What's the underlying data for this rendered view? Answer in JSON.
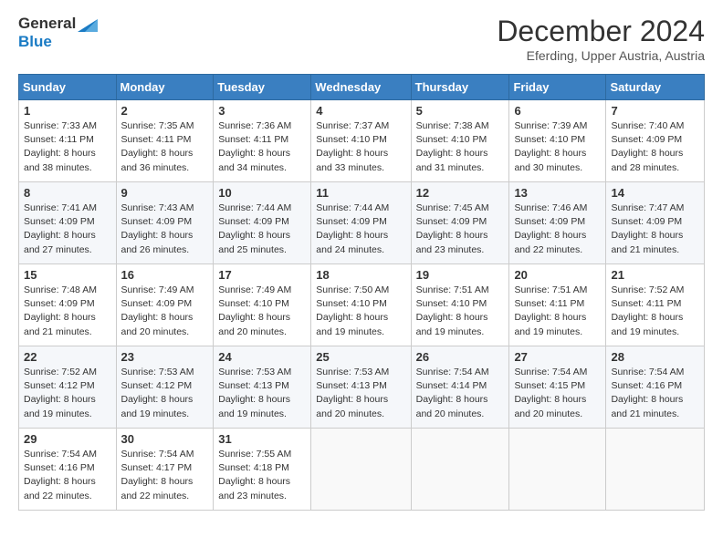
{
  "logo": {
    "line1": "General",
    "line2": "Blue"
  },
  "header": {
    "month": "December 2024",
    "location": "Eferding, Upper Austria, Austria"
  },
  "weekdays": [
    "Sunday",
    "Monday",
    "Tuesday",
    "Wednesday",
    "Thursday",
    "Friday",
    "Saturday"
  ],
  "weeks": [
    [
      {
        "day": "1",
        "sunrise": "7:33 AM",
        "sunset": "4:11 PM",
        "daylight": "8 hours and 38 minutes."
      },
      {
        "day": "2",
        "sunrise": "7:35 AM",
        "sunset": "4:11 PM",
        "daylight": "8 hours and 36 minutes."
      },
      {
        "day": "3",
        "sunrise": "7:36 AM",
        "sunset": "4:11 PM",
        "daylight": "8 hours and 34 minutes."
      },
      {
        "day": "4",
        "sunrise": "7:37 AM",
        "sunset": "4:10 PM",
        "daylight": "8 hours and 33 minutes."
      },
      {
        "day": "5",
        "sunrise": "7:38 AM",
        "sunset": "4:10 PM",
        "daylight": "8 hours and 31 minutes."
      },
      {
        "day": "6",
        "sunrise": "7:39 AM",
        "sunset": "4:10 PM",
        "daylight": "8 hours and 30 minutes."
      },
      {
        "day": "7",
        "sunrise": "7:40 AM",
        "sunset": "4:09 PM",
        "daylight": "8 hours and 28 minutes."
      }
    ],
    [
      {
        "day": "8",
        "sunrise": "7:41 AM",
        "sunset": "4:09 PM",
        "daylight": "8 hours and 27 minutes."
      },
      {
        "day": "9",
        "sunrise": "7:43 AM",
        "sunset": "4:09 PM",
        "daylight": "8 hours and 26 minutes."
      },
      {
        "day": "10",
        "sunrise": "7:44 AM",
        "sunset": "4:09 PM",
        "daylight": "8 hours and 25 minutes."
      },
      {
        "day": "11",
        "sunrise": "7:44 AM",
        "sunset": "4:09 PM",
        "daylight": "8 hours and 24 minutes."
      },
      {
        "day": "12",
        "sunrise": "7:45 AM",
        "sunset": "4:09 PM",
        "daylight": "8 hours and 23 minutes."
      },
      {
        "day": "13",
        "sunrise": "7:46 AM",
        "sunset": "4:09 PM",
        "daylight": "8 hours and 22 minutes."
      },
      {
        "day": "14",
        "sunrise": "7:47 AM",
        "sunset": "4:09 PM",
        "daylight": "8 hours and 21 minutes."
      }
    ],
    [
      {
        "day": "15",
        "sunrise": "7:48 AM",
        "sunset": "4:09 PM",
        "daylight": "8 hours and 21 minutes."
      },
      {
        "day": "16",
        "sunrise": "7:49 AM",
        "sunset": "4:09 PM",
        "daylight": "8 hours and 20 minutes."
      },
      {
        "day": "17",
        "sunrise": "7:49 AM",
        "sunset": "4:10 PM",
        "daylight": "8 hours and 20 minutes."
      },
      {
        "day": "18",
        "sunrise": "7:50 AM",
        "sunset": "4:10 PM",
        "daylight": "8 hours and 19 minutes."
      },
      {
        "day": "19",
        "sunrise": "7:51 AM",
        "sunset": "4:10 PM",
        "daylight": "8 hours and 19 minutes."
      },
      {
        "day": "20",
        "sunrise": "7:51 AM",
        "sunset": "4:11 PM",
        "daylight": "8 hours and 19 minutes."
      },
      {
        "day": "21",
        "sunrise": "7:52 AM",
        "sunset": "4:11 PM",
        "daylight": "8 hours and 19 minutes."
      }
    ],
    [
      {
        "day": "22",
        "sunrise": "7:52 AM",
        "sunset": "4:12 PM",
        "daylight": "8 hours and 19 minutes."
      },
      {
        "day": "23",
        "sunrise": "7:53 AM",
        "sunset": "4:12 PM",
        "daylight": "8 hours and 19 minutes."
      },
      {
        "day": "24",
        "sunrise": "7:53 AM",
        "sunset": "4:13 PM",
        "daylight": "8 hours and 19 minutes."
      },
      {
        "day": "25",
        "sunrise": "7:53 AM",
        "sunset": "4:13 PM",
        "daylight": "8 hours and 20 minutes."
      },
      {
        "day": "26",
        "sunrise": "7:54 AM",
        "sunset": "4:14 PM",
        "daylight": "8 hours and 20 minutes."
      },
      {
        "day": "27",
        "sunrise": "7:54 AM",
        "sunset": "4:15 PM",
        "daylight": "8 hours and 20 minutes."
      },
      {
        "day": "28",
        "sunrise": "7:54 AM",
        "sunset": "4:16 PM",
        "daylight": "8 hours and 21 minutes."
      }
    ],
    [
      {
        "day": "29",
        "sunrise": "7:54 AM",
        "sunset": "4:16 PM",
        "daylight": "8 hours and 22 minutes."
      },
      {
        "day": "30",
        "sunrise": "7:54 AM",
        "sunset": "4:17 PM",
        "daylight": "8 hours and 22 minutes."
      },
      {
        "day": "31",
        "sunrise": "7:55 AM",
        "sunset": "4:18 PM",
        "daylight": "8 hours and 23 minutes."
      },
      null,
      null,
      null,
      null
    ]
  ]
}
